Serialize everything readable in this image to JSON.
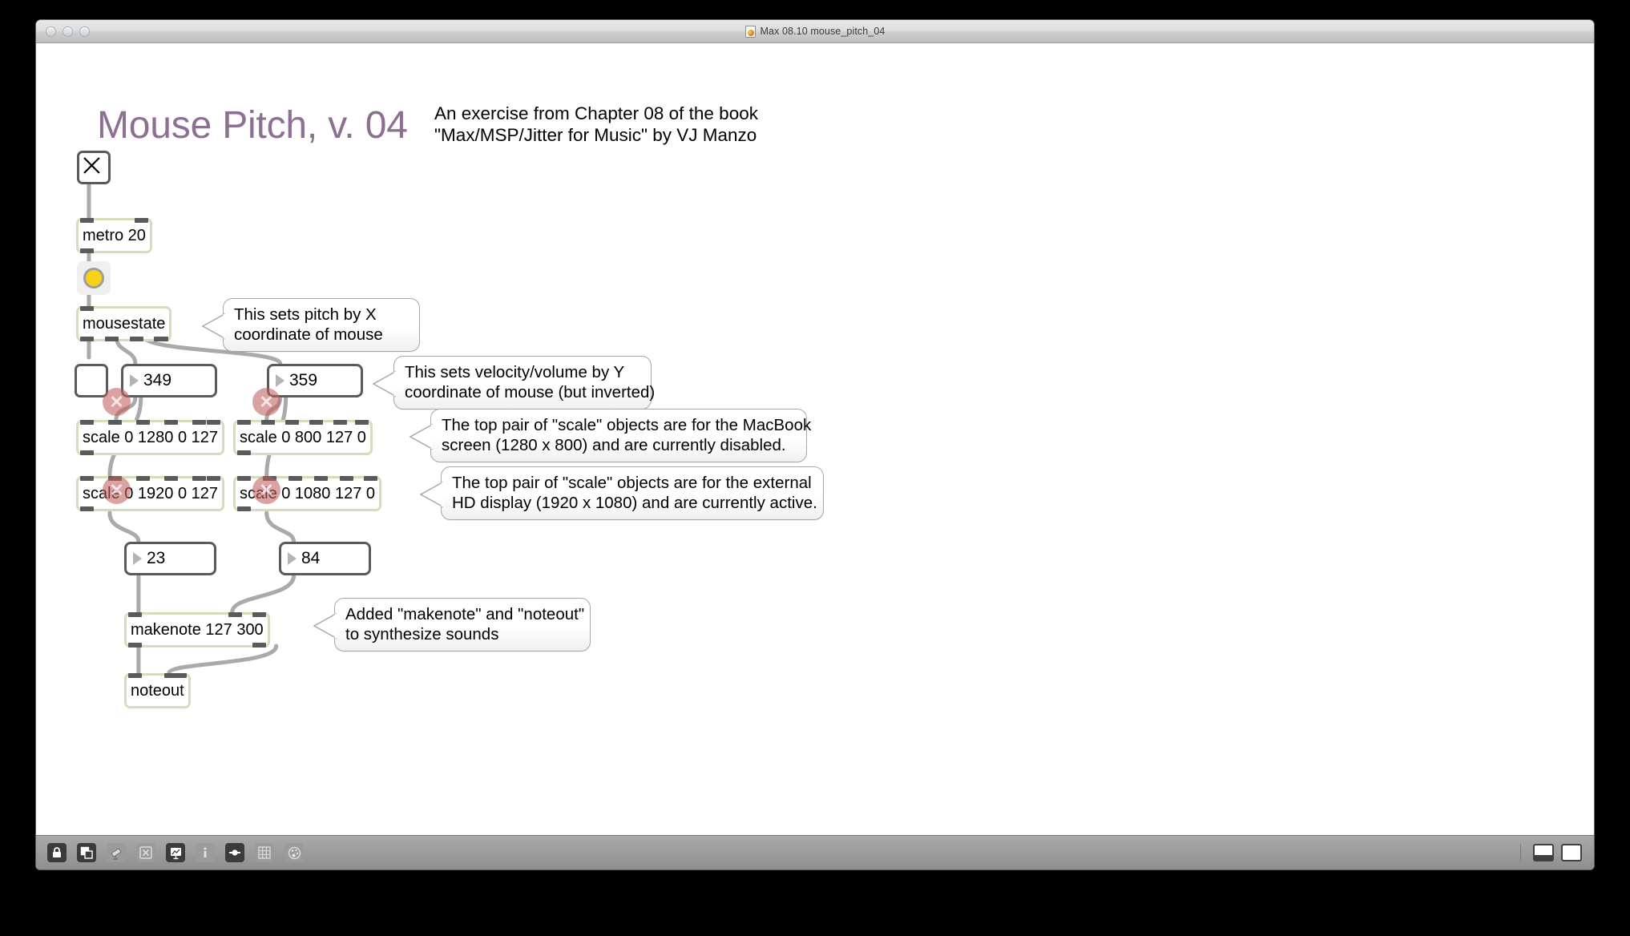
{
  "window": {
    "title": "Max 08.10 mouse_pitch_04",
    "doc_icon": "max-patcher-document-icon",
    "traffic_lights": [
      "close",
      "minimize",
      "zoom"
    ]
  },
  "patch": {
    "title": "Mouse Pitch, v. 04",
    "title_color": "#8e6f94",
    "subtitle_line1": "An exercise from Chapter 08 of the book",
    "subtitle_line2": "\"Max/MSP/Jitter for Music\" by VJ Manzo",
    "objects": {
      "toggle": "",
      "metro": "metro 20",
      "bang": "",
      "mousestate": "mousestate",
      "toggle2": "",
      "numbox_x": "349",
      "numbox_y": "359",
      "scale_mac_x": "scale 0 1280 0 127",
      "scale_mac_y": "scale 0 800 127 0",
      "scale_hd_x": "scale 0 1920 0 127",
      "scale_hd_y": "scale 0 1080 127 0",
      "numbox_pitch": "23",
      "numbox_velocity": "84",
      "makenote": "makenote 127 300",
      "noteout": "noteout"
    },
    "comments": {
      "pitch": "This sets pitch by X\ncoordinate of mouse",
      "velocity": "This sets velocity/volume by Y\ncoordinate of mouse (but inverted)",
      "macbook": "The top pair of \"scale\" objects are for the MacBook\nscreen (1280 x 800) and are currently disabled.",
      "hd": "The top pair of \"scale\" objects are for the external\nHD display (1920 x 1080) and are currently active.",
      "makenote": "Added \"makenote\" and \"noteout\"\nto synthesize sounds"
    },
    "colors": {
      "object_border": "#d3dfb8",
      "nub": "#5a5a5a",
      "bang_fill": "#f5d117",
      "disabled_marker": "#c15f5f",
      "wire": "#aaaaaa"
    }
  },
  "toolbar": {
    "left_items": [
      {
        "name": "lock-icon",
        "state": "active"
      },
      {
        "name": "layers-icon",
        "state": "active"
      },
      {
        "name": "telescope-icon",
        "state": "dimmed"
      },
      {
        "name": "object-explorer-icon",
        "state": "dimmed"
      },
      {
        "name": "presentation-icon",
        "state": "active"
      },
      {
        "name": "info-icon",
        "state": "dimmed"
      },
      {
        "name": "inspector-icon",
        "state": "active"
      },
      {
        "name": "grid-icon",
        "state": "dimmed"
      },
      {
        "name": "palette-icon",
        "state": "dimmed"
      }
    ],
    "right_items": [
      {
        "name": "sidebar-toggle-icon",
        "state": "active"
      },
      {
        "name": "panel-toggle-icon",
        "state": "active"
      }
    ]
  }
}
